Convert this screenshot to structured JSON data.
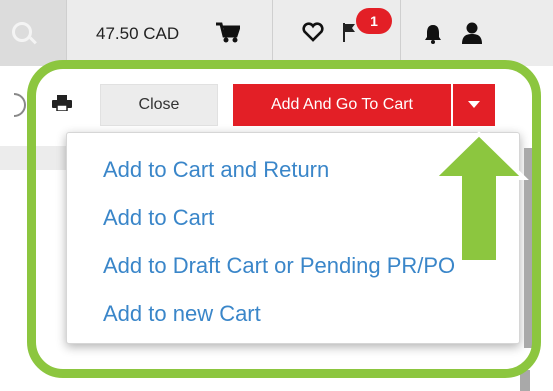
{
  "header": {
    "cart_total": "47.50 CAD",
    "notification_count": "1",
    "icons": [
      "search-icon",
      "cart-icon",
      "heart-icon",
      "flag-icon",
      "bell-icon",
      "user-icon"
    ]
  },
  "toolbar": {
    "close_label": "Close",
    "primary_label": "Add And Go To Cart",
    "icons": [
      "print-icon",
      "caret-down-icon"
    ]
  },
  "menu": {
    "items": [
      "Add to Cart and Return",
      "Add to Cart",
      "Add to Draft Cart or Pending PR/PO",
      "Add to new Cart"
    ]
  },
  "colors": {
    "accent_red": "#e31f26",
    "link_blue": "#3a86c9",
    "highlight_green": "#8cc63f"
  }
}
